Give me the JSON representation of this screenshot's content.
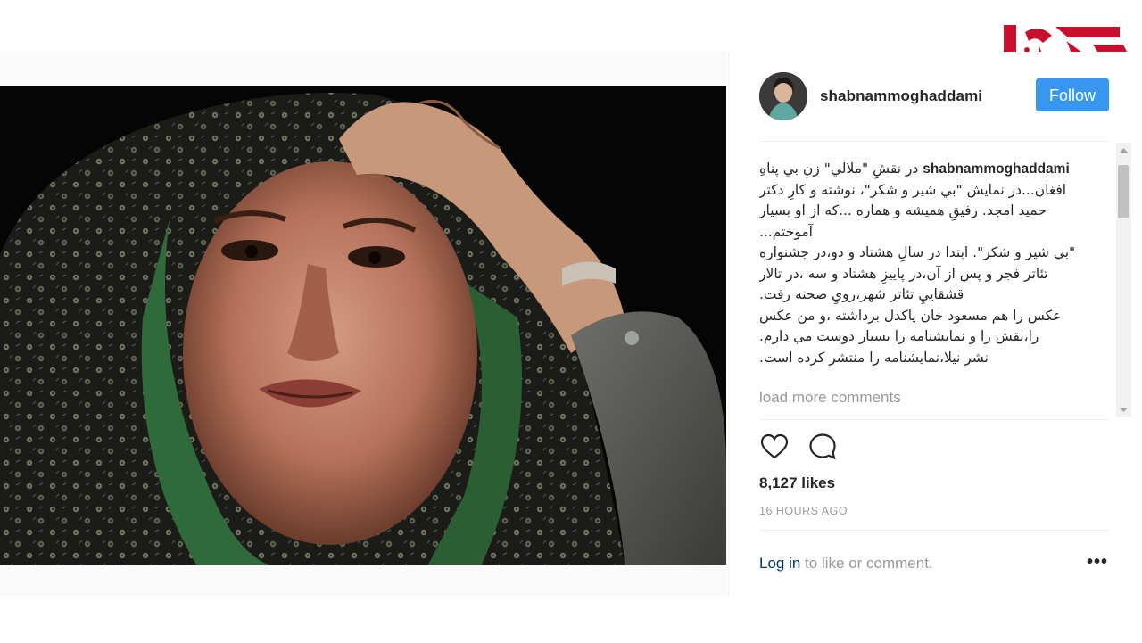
{
  "post": {
    "username": "shabnammoghaddami",
    "follow_label": "Follow",
    "caption_username": "shabnammoghaddami",
    "caption_text": " در نقشِ \"ملالي\" زنِ بي پناهِ افغان...در نمايش \"بي شير و شكر\"، نوشته و كارِ دكتر حميد امجد. رفيقِ هميشه و هماره ...كه از او بسيار آموختم...\n\"بي شير و شكر\". ابتدا در سالِ هشتاد و دو،در جشنواره تئاتر فجر و پس از آن،در پاييزِ هشتاد و سه ،در تالار قشقاييِ تئاتر شهر،رويِ صحنه رفت.\nعكس را هم مسعود خان پاكدل برداشته ،و من عكس را،نقش را و نمايشنامه را بسيار دوست مي دارم.\nنشر نيلا،نمايشنامه را منتشر كرده است.",
    "load_more": "load more comments",
    "likes": "8,127 likes",
    "time": "16 HOURS AGO",
    "footer_login": "Log in",
    "footer_rest": " to like or comment.",
    "more_label": "•••"
  },
  "icons": {
    "like": "heart-icon",
    "comment": "comment-icon",
    "more": "more-options-icon"
  },
  "colors": {
    "follow_button": "#3897f0",
    "login_link": "#003569",
    "muted_text": "#999999",
    "logo_red": "#c8102e"
  }
}
